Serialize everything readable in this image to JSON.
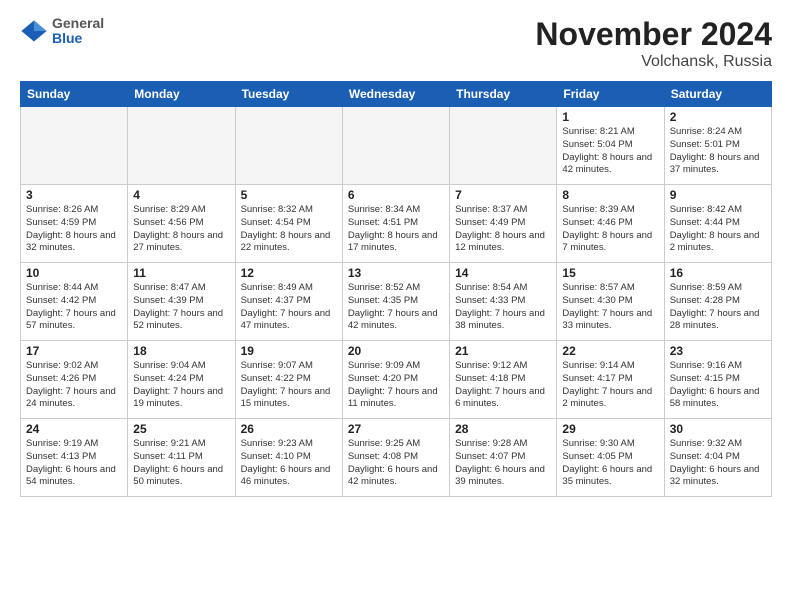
{
  "header": {
    "logo": {
      "general": "General",
      "blue": "Blue"
    },
    "title": "November 2024",
    "location": "Volchansk, Russia"
  },
  "weekdays": [
    "Sunday",
    "Monday",
    "Tuesday",
    "Wednesday",
    "Thursday",
    "Friday",
    "Saturday"
  ],
  "weeks": [
    [
      {
        "day": "",
        "info": "",
        "empty": true
      },
      {
        "day": "",
        "info": "",
        "empty": true
      },
      {
        "day": "",
        "info": "",
        "empty": true
      },
      {
        "day": "",
        "info": "",
        "empty": true
      },
      {
        "day": "",
        "info": "",
        "empty": true
      },
      {
        "day": "1",
        "info": "Sunrise: 8:21 AM\nSunset: 5:04 PM\nDaylight: 8 hours\nand 42 minutes.",
        "empty": false
      },
      {
        "day": "2",
        "info": "Sunrise: 8:24 AM\nSunset: 5:01 PM\nDaylight: 8 hours\nand 37 minutes.",
        "empty": false
      }
    ],
    [
      {
        "day": "3",
        "info": "Sunrise: 8:26 AM\nSunset: 4:59 PM\nDaylight: 8 hours\nand 32 minutes.",
        "empty": false
      },
      {
        "day": "4",
        "info": "Sunrise: 8:29 AM\nSunset: 4:56 PM\nDaylight: 8 hours\nand 27 minutes.",
        "empty": false
      },
      {
        "day": "5",
        "info": "Sunrise: 8:32 AM\nSunset: 4:54 PM\nDaylight: 8 hours\nand 22 minutes.",
        "empty": false
      },
      {
        "day": "6",
        "info": "Sunrise: 8:34 AM\nSunset: 4:51 PM\nDaylight: 8 hours\nand 17 minutes.",
        "empty": false
      },
      {
        "day": "7",
        "info": "Sunrise: 8:37 AM\nSunset: 4:49 PM\nDaylight: 8 hours\nand 12 minutes.",
        "empty": false
      },
      {
        "day": "8",
        "info": "Sunrise: 8:39 AM\nSunset: 4:46 PM\nDaylight: 8 hours\nand 7 minutes.",
        "empty": false
      },
      {
        "day": "9",
        "info": "Sunrise: 8:42 AM\nSunset: 4:44 PM\nDaylight: 8 hours\nand 2 minutes.",
        "empty": false
      }
    ],
    [
      {
        "day": "10",
        "info": "Sunrise: 8:44 AM\nSunset: 4:42 PM\nDaylight: 7 hours\nand 57 minutes.",
        "empty": false
      },
      {
        "day": "11",
        "info": "Sunrise: 8:47 AM\nSunset: 4:39 PM\nDaylight: 7 hours\nand 52 minutes.",
        "empty": false
      },
      {
        "day": "12",
        "info": "Sunrise: 8:49 AM\nSunset: 4:37 PM\nDaylight: 7 hours\nand 47 minutes.",
        "empty": false
      },
      {
        "day": "13",
        "info": "Sunrise: 8:52 AM\nSunset: 4:35 PM\nDaylight: 7 hours\nand 42 minutes.",
        "empty": false
      },
      {
        "day": "14",
        "info": "Sunrise: 8:54 AM\nSunset: 4:33 PM\nDaylight: 7 hours\nand 38 minutes.",
        "empty": false
      },
      {
        "day": "15",
        "info": "Sunrise: 8:57 AM\nSunset: 4:30 PM\nDaylight: 7 hours\nand 33 minutes.",
        "empty": false
      },
      {
        "day": "16",
        "info": "Sunrise: 8:59 AM\nSunset: 4:28 PM\nDaylight: 7 hours\nand 28 minutes.",
        "empty": false
      }
    ],
    [
      {
        "day": "17",
        "info": "Sunrise: 9:02 AM\nSunset: 4:26 PM\nDaylight: 7 hours\nand 24 minutes.",
        "empty": false
      },
      {
        "day": "18",
        "info": "Sunrise: 9:04 AM\nSunset: 4:24 PM\nDaylight: 7 hours\nand 19 minutes.",
        "empty": false
      },
      {
        "day": "19",
        "info": "Sunrise: 9:07 AM\nSunset: 4:22 PM\nDaylight: 7 hours\nand 15 minutes.",
        "empty": false
      },
      {
        "day": "20",
        "info": "Sunrise: 9:09 AM\nSunset: 4:20 PM\nDaylight: 7 hours\nand 11 minutes.",
        "empty": false
      },
      {
        "day": "21",
        "info": "Sunrise: 9:12 AM\nSunset: 4:18 PM\nDaylight: 7 hours\nand 6 minutes.",
        "empty": false
      },
      {
        "day": "22",
        "info": "Sunrise: 9:14 AM\nSunset: 4:17 PM\nDaylight: 7 hours\nand 2 minutes.",
        "empty": false
      },
      {
        "day": "23",
        "info": "Sunrise: 9:16 AM\nSunset: 4:15 PM\nDaylight: 6 hours\nand 58 minutes.",
        "empty": false
      }
    ],
    [
      {
        "day": "24",
        "info": "Sunrise: 9:19 AM\nSunset: 4:13 PM\nDaylight: 6 hours\nand 54 minutes.",
        "empty": false
      },
      {
        "day": "25",
        "info": "Sunrise: 9:21 AM\nSunset: 4:11 PM\nDaylight: 6 hours\nand 50 minutes.",
        "empty": false
      },
      {
        "day": "26",
        "info": "Sunrise: 9:23 AM\nSunset: 4:10 PM\nDaylight: 6 hours\nand 46 minutes.",
        "empty": false
      },
      {
        "day": "27",
        "info": "Sunrise: 9:25 AM\nSunset: 4:08 PM\nDaylight: 6 hours\nand 42 minutes.",
        "empty": false
      },
      {
        "day": "28",
        "info": "Sunrise: 9:28 AM\nSunset: 4:07 PM\nDaylight: 6 hours\nand 39 minutes.",
        "empty": false
      },
      {
        "day": "29",
        "info": "Sunrise: 9:30 AM\nSunset: 4:05 PM\nDaylight: 6 hours\nand 35 minutes.",
        "empty": false
      },
      {
        "day": "30",
        "info": "Sunrise: 9:32 AM\nSunset: 4:04 PM\nDaylight: 6 hours\nand 32 minutes.",
        "empty": false
      }
    ]
  ]
}
